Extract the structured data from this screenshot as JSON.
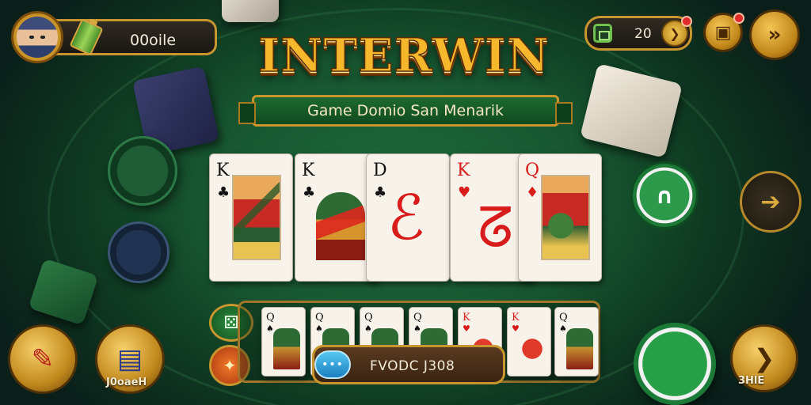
{
  "header": {
    "player_name": "00oile",
    "coins": "20"
  },
  "title": {
    "main": "INTERWIN",
    "subtitle": "Game Domio San Menarik"
  },
  "table_cards": [
    {
      "rank": "K",
      "suit": "♣",
      "color": "black"
    },
    {
      "rank": "K",
      "suit": "♣",
      "color": "black"
    },
    {
      "rank": "D",
      "suit": "♣",
      "color": "black"
    },
    {
      "rank": "K",
      "suit": "♥",
      "color": "red"
    },
    {
      "rank": "Q",
      "suit": "♦",
      "color": "red"
    }
  ],
  "hand_cards": [
    {
      "rank": "Q",
      "suit": "♠"
    },
    {
      "rank": "Q",
      "suit": "♠"
    },
    {
      "rank": "Q",
      "suit": "♠"
    },
    {
      "rank": "Q",
      "suit": "♠"
    },
    {
      "rank": "K",
      "suit": "♥"
    },
    {
      "rank": "K",
      "suit": "♥"
    },
    {
      "rank": "Q",
      "suit": "♠"
    }
  ],
  "bottom": {
    "code_text": "FVODC J308",
    "chat_icon_text": "•••",
    "left_button_label": "J0oaeH",
    "right_button_label": "3HlE"
  },
  "icons": {
    "battery": "battery-icon",
    "chest": "chest-icon",
    "lock": "lock-icon",
    "forward": "fast-forward-icon",
    "arrow": "arrow-right-icon",
    "chat": "chat-bubble-icon"
  },
  "colors": {
    "gold": "#c8952e",
    "felt": "#1f6b3e",
    "title": "#f5b72c"
  }
}
